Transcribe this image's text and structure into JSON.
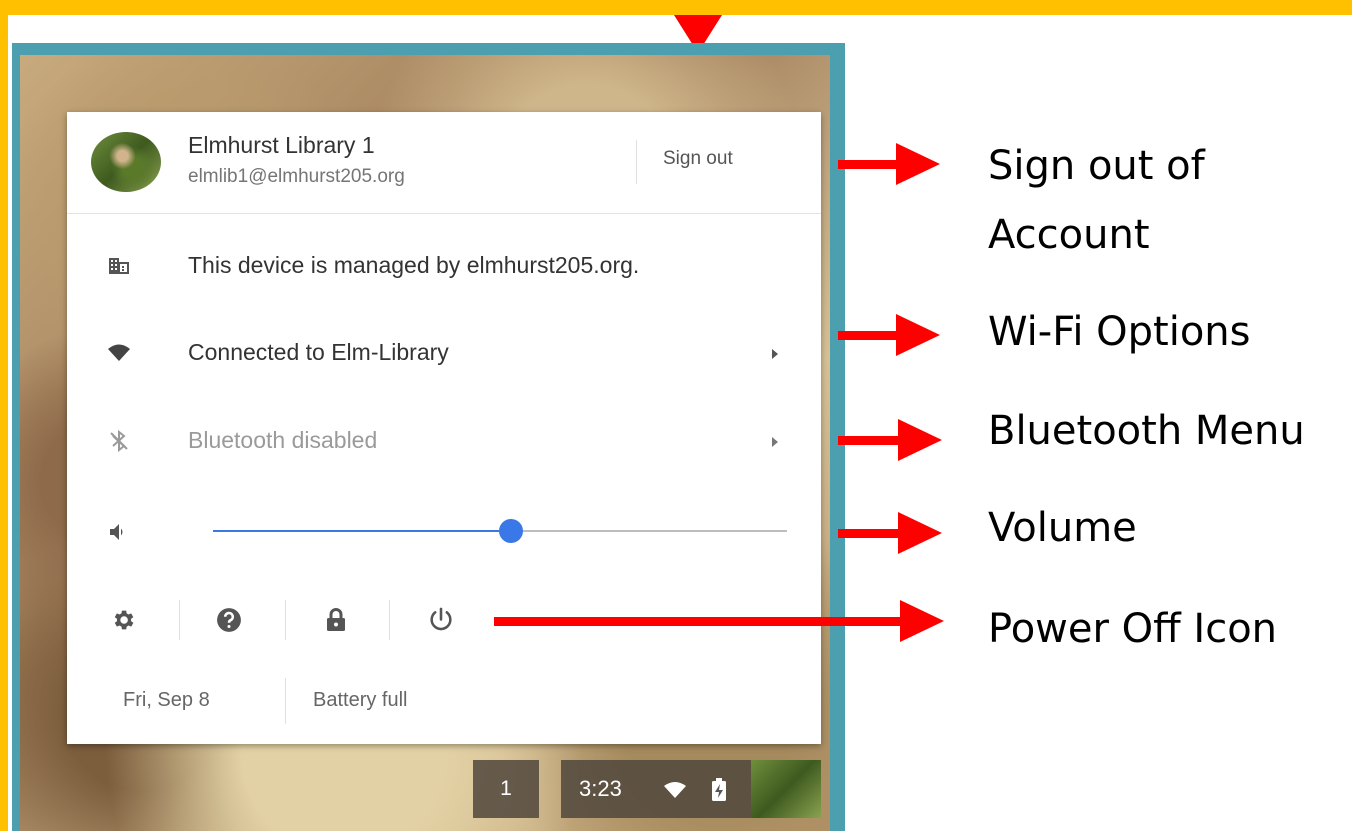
{
  "user": {
    "name": "Elmhurst Library 1",
    "email": "elmlib1@elmhurst205.org",
    "sign_out_label": "Sign out"
  },
  "rows": {
    "managed_text": "This device is managed by elmhurst205.org.",
    "wifi_text": "Connected to Elm-Library",
    "bluetooth_text": "Bluetooth disabled"
  },
  "volume": {
    "level": 0.52
  },
  "actions": [
    "gear-icon",
    "help-icon",
    "lock-icon",
    "power-icon"
  ],
  "footer": {
    "date": "Fri, Sep 8",
    "battery": "Battery full"
  },
  "shelf": {
    "window_count": "1",
    "time": "3:23"
  },
  "annotations": {
    "sign_out_line1": "Sign out of",
    "sign_out_line2": "Account",
    "wifi": "Wi-Fi Options",
    "bluetooth": "Bluetooth Menu",
    "volume": "Volume",
    "power": "Power Off Icon"
  },
  "colors": {
    "frame": "#FFC000",
    "border": "#4B9FAE",
    "accent": "#3b78e7",
    "arrow": "#FF0000"
  }
}
